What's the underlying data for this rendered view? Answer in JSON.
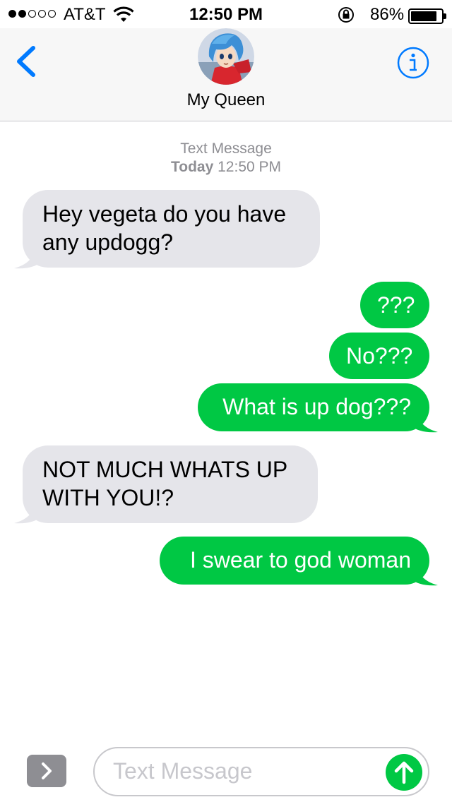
{
  "status_bar": {
    "carrier": "AT&T",
    "time": "12:50 PM",
    "battery_percent": "86%",
    "battery_level": 0.86,
    "signal_bars_filled": 2,
    "signal_bars_total": 5
  },
  "header": {
    "contact_name": "My Queen"
  },
  "thread": {
    "service": "Text Message",
    "day": "Today",
    "time": "12:50 PM"
  },
  "messages": [
    {
      "direction": "incoming",
      "text": "Hey vegeta do you have any updogg?"
    },
    {
      "direction": "outgoing",
      "text": "???"
    },
    {
      "direction": "outgoing",
      "text": "No???"
    },
    {
      "direction": "outgoing",
      "text": "What is up dog???"
    },
    {
      "direction": "incoming",
      "text": "NOT MUCH WHATS UP WITH YOU!?"
    },
    {
      "direction": "outgoing",
      "text": "I swear to god woman"
    }
  ],
  "composer": {
    "placeholder": "Text Message"
  },
  "colors": {
    "accent_blue": "#007aff",
    "outgoing_green": "#00c844",
    "incoming_gray": "#e5e5ea"
  },
  "icons": {
    "back": "chevron-left-icon",
    "info": "info-icon",
    "expand": "chevron-right-icon",
    "send": "arrow-up-icon",
    "wifi": "wifi-icon",
    "orientation_lock": "orientation-lock-icon"
  }
}
